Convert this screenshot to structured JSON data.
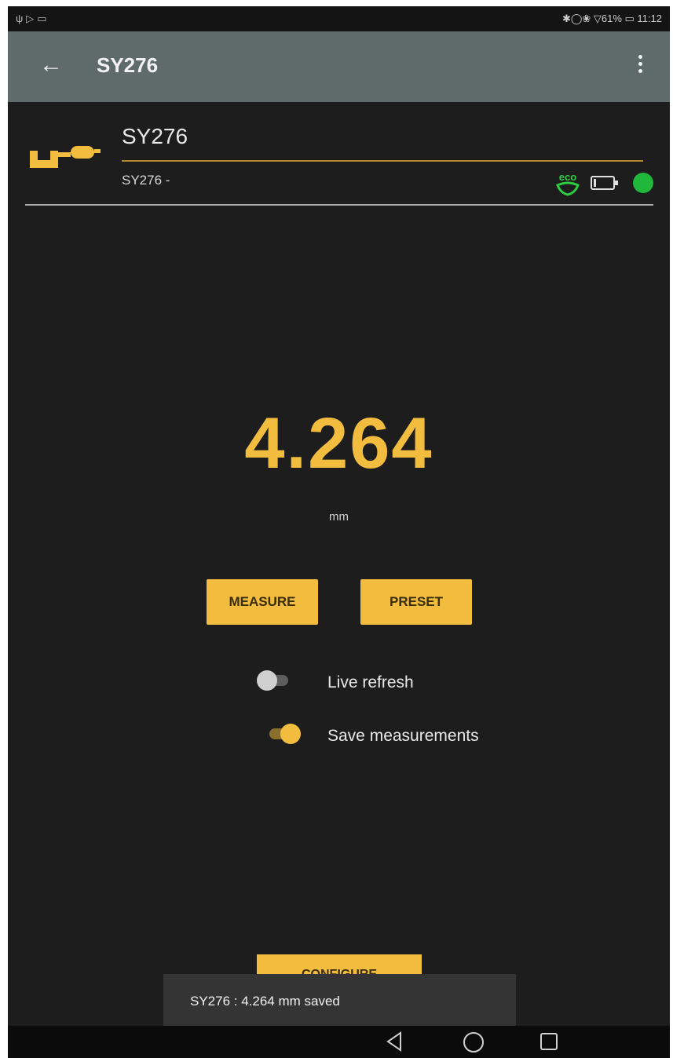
{
  "status_bar": {
    "left_icons": [
      "usb-icon",
      "play-icon",
      "notification-icon"
    ],
    "right_text": "✱◯❀ ▽61% ▭ 11:12",
    "battery": "61%",
    "time": "11:12"
  },
  "app_bar": {
    "title": "SY276",
    "back_icon": "arrow-left-icon",
    "menu_icon": "more-vert-icon"
  },
  "device": {
    "name": "SY276",
    "subtitle": "SY276 -",
    "icon": "micrometer-icon",
    "status_icons": [
      "eco-icon",
      "battery-icon",
      "connection-status-icon"
    ],
    "connection_color": "#1fb83a"
  },
  "measurement": {
    "value": "4.264",
    "unit": "mm"
  },
  "buttons": {
    "measure": "MEASURE",
    "preset": "PRESET",
    "configure": "CONFIGURE"
  },
  "toggles": [
    {
      "label": "Live refresh",
      "on": false
    },
    {
      "label": "Save measurements",
      "on": true
    }
  ],
  "snackbar": {
    "message": "SY276 : 4.264 mm saved"
  },
  "colors": {
    "accent": "#f2bd3f",
    "background": "#1d1d1d",
    "app_bar": "#5f6b6a"
  }
}
